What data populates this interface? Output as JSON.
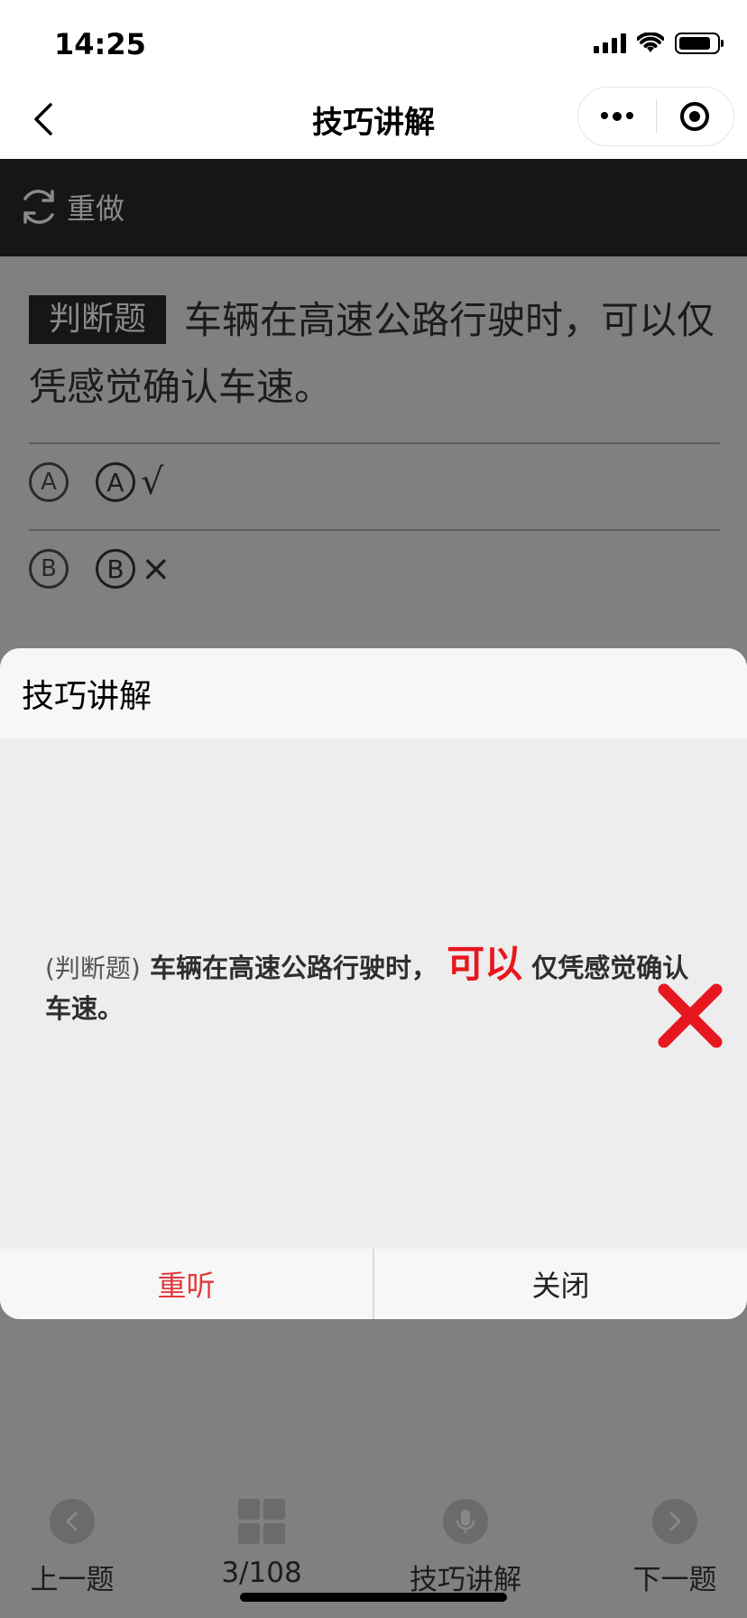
{
  "status_bar": {
    "time": "14:25"
  },
  "nav": {
    "title": "技巧讲解"
  },
  "toolbar": {
    "redo_label": "重做"
  },
  "question": {
    "type_tag": "判断题",
    "text": "车辆在高速公路行驶时，可以仅凭感觉确认车速。"
  },
  "options": [
    {
      "marker": "A",
      "letter": "A",
      "text": "√"
    },
    {
      "marker": "B",
      "letter": "B",
      "text": "×"
    }
  ],
  "modal": {
    "title": "技巧讲解",
    "tip": {
      "prefix": "(判断题)",
      "text_before": "车辆在高速公路行驶时，",
      "highlight": "可以",
      "text_after": "仅凭感觉确认车速。"
    },
    "replay_label": "重听",
    "close_label": "关闭"
  },
  "bottom_bar": {
    "prev_label": "上一题",
    "progress": "3/108",
    "tips_label": "技巧讲解",
    "next_label": "下一题"
  },
  "colors": {
    "highlight_red": "#e8171f",
    "replay_red": "#e4393c",
    "toolbar_bg": "#161616"
  }
}
